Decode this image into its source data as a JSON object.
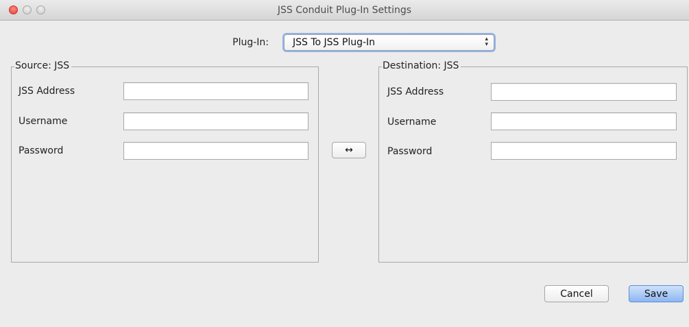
{
  "window": {
    "title": "JSS Conduit Plug-In Settings"
  },
  "plugin": {
    "label": "Plug-In:",
    "selected": "JSS To JSS Plug-In"
  },
  "source": {
    "legend": "Source: JSS",
    "address_label": "JSS Address",
    "username_label": "Username",
    "password_label": "Password",
    "address_value": "",
    "username_value": "",
    "password_value": ""
  },
  "destination": {
    "legend": "Destination: JSS",
    "address_label": "JSS Address",
    "username_label": "Username",
    "password_label": "Password",
    "address_value": "",
    "username_value": "",
    "password_value": ""
  },
  "swap_button": {
    "label": "↔"
  },
  "footer": {
    "cancel_label": "Cancel",
    "save_label": "Save"
  },
  "colors": {
    "window_background": "#ececec",
    "default_button_blue": "#8db6f1",
    "close_red": "#e0443e"
  }
}
